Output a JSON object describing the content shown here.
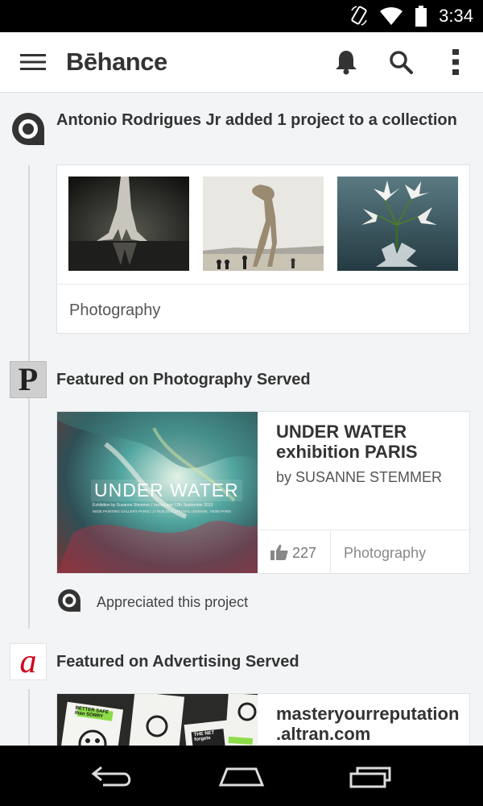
{
  "status_bar": {
    "time": "3:34",
    "icons": [
      "rotate-icon",
      "wifi-icon",
      "battery-icon"
    ]
  },
  "app_bar": {
    "logo": "Bēhance",
    "actions": [
      "menu-icon",
      "notifications-icon",
      "search-icon",
      "more-vert-icon"
    ]
  },
  "colors": {
    "background": "#f2f4f6",
    "status_bar": "#000000",
    "app_bar": "#ffffff",
    "advertising_served_red": "#d0021b"
  },
  "feed": {
    "activities": [
      {
        "avatar_icon": "behance-user-icon",
        "title": "Antonio Rodrigues Jr added 1 project to a collection",
        "collection_label": "Photography",
        "thumbnails": [
          "cypress-tree-thumbnail",
          "sculpture-figure-thumbnail",
          "white-lilies-thumbnail"
        ]
      },
      {
        "avatar_icon": "photography-served-icon",
        "avatar_letter": "P",
        "title": "Featured on Photography Served",
        "project": {
          "cover_title": "UNDER WATER",
          "cover_caption": "Exhibition by Susanne Stemmer | Vernissage 12th September 2013",
          "cover_caption_2": "WIDE PAINTING GALLERY PARIS | 17 RUE DU CARDINAL LEMOINE, 75005 PARIS",
          "title": "UNDER WATER exhibition PARIS",
          "author": "by SUSANNE STEMMER",
          "appreciations": "227",
          "field": "Photography"
        },
        "appreciated_text": "Appreciated this project"
      },
      {
        "avatar_icon": "advertising-served-icon",
        "avatar_letter": "a",
        "title": "Featured on Advertising Served",
        "project": {
          "title": "masteryourreputation .altran.com",
          "cover_texts": [
            "BETTER SAFE than SORRY",
            "THE NET forgets"
          ]
        }
      }
    ]
  },
  "nav_bar": {
    "buttons": [
      "back-icon",
      "home-icon",
      "recent-apps-icon"
    ]
  }
}
